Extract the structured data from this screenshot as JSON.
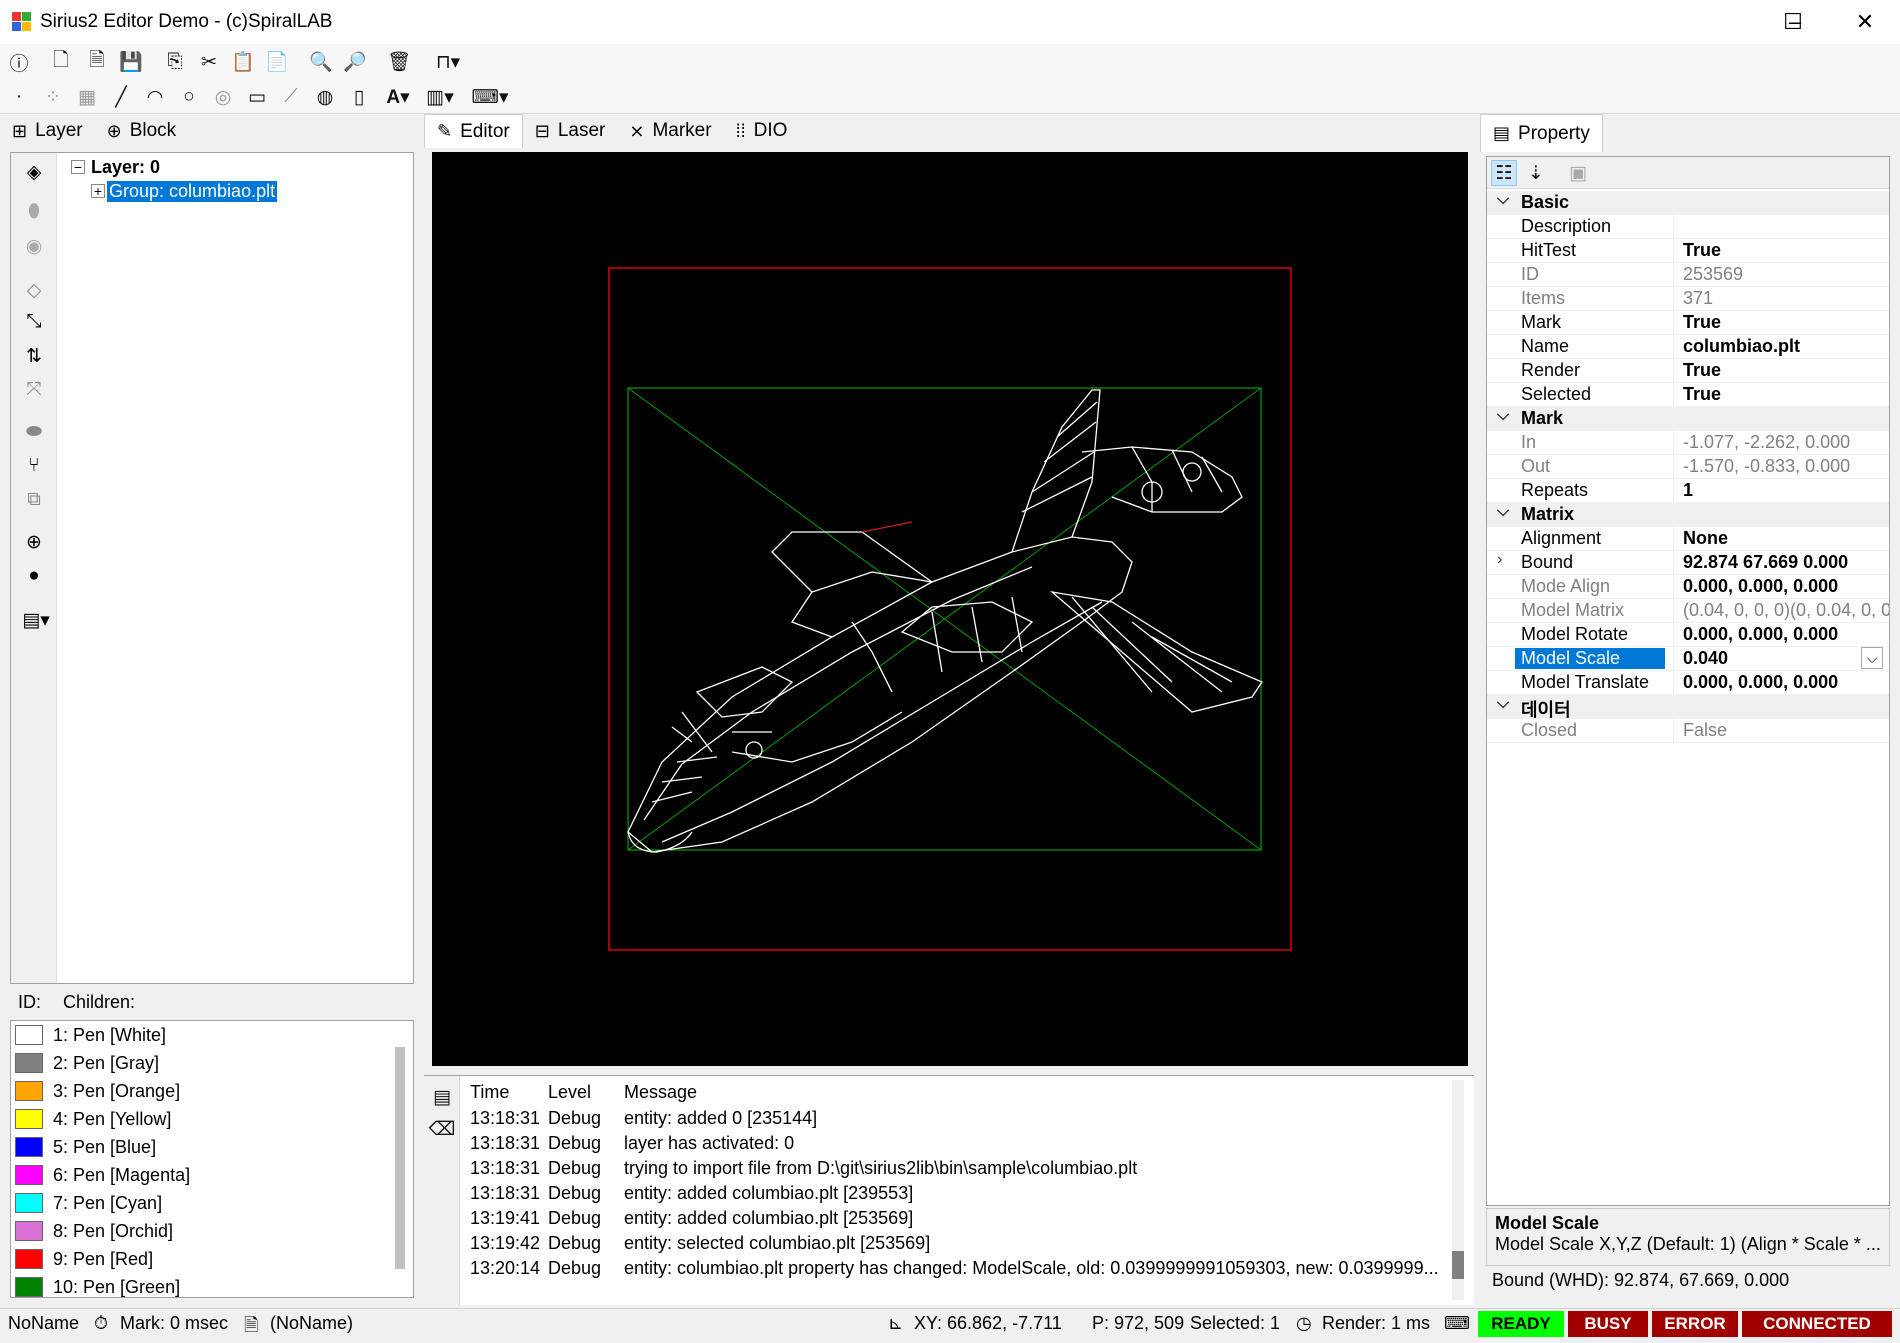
{
  "window": {
    "title": "Sirius2 Editor Demo - (c)SpiralLAB",
    "minimize": "–",
    "maximize": "☐",
    "close": "✕"
  },
  "left_tabs": [
    {
      "label": "Layer"
    },
    {
      "label": "Block"
    }
  ],
  "center_tabs": [
    {
      "label": "Editor"
    },
    {
      "label": "Laser"
    },
    {
      "label": "Marker"
    },
    {
      "label": "DIO"
    }
  ],
  "tree": {
    "layer": "Layer: 0",
    "group": "Group: columbiao.plt"
  },
  "id_bar": {
    "id_label": "ID:",
    "children_label": "Children:"
  },
  "pens": [
    {
      "label": "1: Pen [White]",
      "color": "#ffffff"
    },
    {
      "label": "2: Pen [Gray]",
      "color": "#808080"
    },
    {
      "label": "3: Pen [Orange]",
      "color": "#ffa500"
    },
    {
      "label": "4: Pen [Yellow]",
      "color": "#ffff00"
    },
    {
      "label": "5: Pen [Blue]",
      "color": "#0000ff"
    },
    {
      "label": "6: Pen [Magenta]",
      "color": "#ff00ff"
    },
    {
      "label": "7: Pen [Cyan]",
      "color": "#00ffff"
    },
    {
      "label": "8: Pen [Orchid]",
      "color": "#da70d6"
    },
    {
      "label": "9: Pen [Red]",
      "color": "#ff0000"
    },
    {
      "label": "10: Pen [Green]",
      "color": "#008000"
    }
  ],
  "log": {
    "headers": {
      "time": "Time",
      "level": "Level",
      "message": "Message"
    },
    "rows": [
      {
        "time": "13:18:31",
        "level": "Debug",
        "message": "entity: added 0 [235144]"
      },
      {
        "time": "13:18:31",
        "level": "Debug",
        "message": "layer has activated: 0"
      },
      {
        "time": "13:18:31",
        "level": "Debug",
        "message": "trying to import file from D:\\git\\sirius2lib\\bin\\sample\\columbiao.plt"
      },
      {
        "time": "13:18:31",
        "level": "Debug",
        "message": "entity: added columbiao.plt [239553]"
      },
      {
        "time": "13:19:41",
        "level": "Debug",
        "message": "entity: added columbiao.plt [253569]"
      },
      {
        "time": "13:19:42",
        "level": "Debug",
        "message": "entity: selected columbiao.plt [253569]"
      },
      {
        "time": "13:20:14",
        "level": "Debug",
        "message": "entity: columbiao.plt property has changed: ModelScale, old: 0.0399999991059303, new: 0.0399999..."
      }
    ]
  },
  "property": {
    "tab_label": "Property",
    "categories": {
      "basic": "Basic",
      "mark": "Mark",
      "matrix": "Matrix",
      "data": "데이터"
    },
    "basic": [
      {
        "name": "Description",
        "value": ""
      },
      {
        "name": "HitTest",
        "value": "True"
      },
      {
        "name": "ID",
        "value": "253569"
      },
      {
        "name": "Items",
        "value": "371"
      },
      {
        "name": "Mark",
        "value": "True"
      },
      {
        "name": "Name",
        "value": "columbiao.plt"
      },
      {
        "name": "Render",
        "value": "True"
      },
      {
        "name": "Selected",
        "value": "True"
      }
    ],
    "mark": [
      {
        "name": "In",
        "value": "-1.077, -2.262, 0.000"
      },
      {
        "name": "Out",
        "value": "-1.570, -0.833, 0.000"
      },
      {
        "name": "Repeats",
        "value": "1"
      }
    ],
    "matrix": [
      {
        "name": "Alignment",
        "value": "None"
      },
      {
        "name": "Bound",
        "value": "92.874 67.669 0.000"
      },
      {
        "name": "Mode Align",
        "value": "0.000, 0.000, 0.000"
      },
      {
        "name": "Model Matrix",
        "value": "(0.04, 0, 0, 0)(0, 0.04, 0, 0"
      },
      {
        "name": "Model Rotate",
        "value": "0.000, 0.000, 0.000"
      },
      {
        "name": "Model Scale",
        "value": "0.040"
      },
      {
        "name": "Model Translate",
        "value": "0.000, 0.000, 0.000"
      }
    ],
    "data": [
      {
        "name": "Closed",
        "value": "False"
      }
    ],
    "description": {
      "title": "Model Scale",
      "text": "Model Scale X,Y,Z (Default: 1) (Align * Scale * ..."
    },
    "bound": "Bound (WHD): 92.874, 67.669, 0.000"
  },
  "status": {
    "name": "NoName",
    "mark": "Mark: 0 msec",
    "doc": "(NoName)",
    "xy": "XY: 66.862, -7.711",
    "p": "P: 972, 509",
    "selected": "Selected: 1",
    "render": "Render: 1 ms",
    "ready": "READY",
    "busy": "BUSY",
    "error": "ERROR",
    "connected": "CONNECTED",
    "colors": {
      "ready": "#00ff00",
      "busy": "#a00000",
      "error": "#a00000",
      "connected": "#a00000"
    }
  }
}
